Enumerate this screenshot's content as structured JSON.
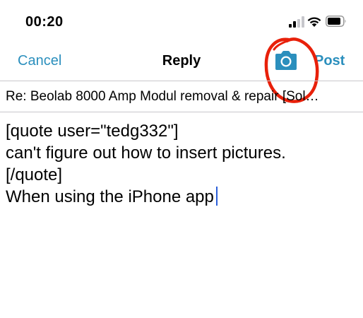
{
  "status_bar": {
    "time": "00:20",
    "signal_icon": "cellular-signal-icon",
    "wifi_icon": "wifi-icon",
    "battery_icon": "battery-icon"
  },
  "nav": {
    "cancel_label": "Cancel",
    "title": "Reply",
    "camera_icon": "camera-icon",
    "post_label": "Post"
  },
  "subject": {
    "value": "Re: Beolab 8000 Amp Modul removal & repair [Sol…"
  },
  "body": {
    "lines": [
      "[quote user=\"tedg332\"]",
      "can't figure out how to insert pictures.",
      "[/quote]",
      "When using the iPhone app"
    ]
  },
  "colors": {
    "accent": "#2b8fbd",
    "annotation": "#e8200a",
    "caret": "#2b5fd9",
    "divider": "#c8c7cc"
  }
}
